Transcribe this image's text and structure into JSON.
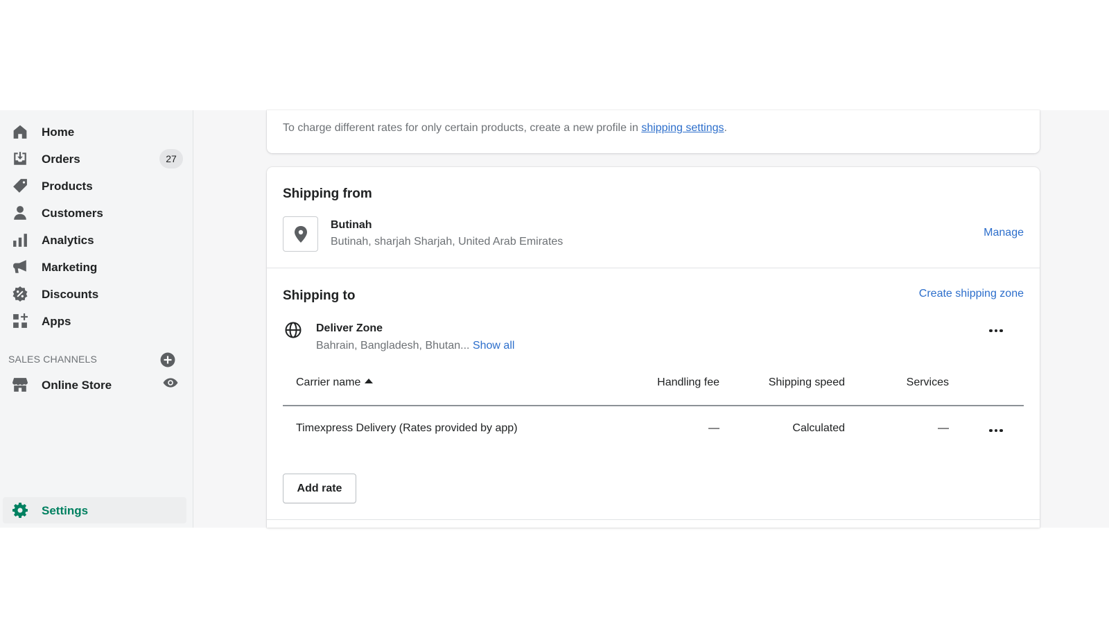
{
  "sidebar": {
    "items": [
      {
        "label": "Home",
        "icon": "home-icon"
      },
      {
        "label": "Orders",
        "icon": "orders-icon",
        "badge": "27"
      },
      {
        "label": "Products",
        "icon": "tag-icon"
      },
      {
        "label": "Customers",
        "icon": "person-icon"
      },
      {
        "label": "Analytics",
        "icon": "bar-chart-icon"
      },
      {
        "label": "Marketing",
        "icon": "megaphone-icon"
      },
      {
        "label": "Discounts",
        "icon": "discount-icon"
      },
      {
        "label": "Apps",
        "icon": "apps-icon"
      }
    ],
    "sales_channels_heading": "SALES CHANNELS",
    "online_store": "Online Store",
    "settings": "Settings"
  },
  "main": {
    "note_text": "To charge different rates for only certain products, create a new profile in ",
    "note_link": "shipping settings",
    "note_end": ".",
    "shipping_from": {
      "heading": "Shipping from",
      "location_name": "Butinah",
      "location_address": "Butinah, sharjah Sharjah, United Arab Emirates",
      "manage": "Manage"
    },
    "shipping_to": {
      "heading": "Shipping to",
      "create_zone": "Create shipping zone",
      "zone_name": "Deliver Zone",
      "zone_countries": "Bahrain, Bangladesh, Bhutan...",
      "show_all": "Show all"
    },
    "table": {
      "headers": [
        "Carrier name",
        "Handling fee",
        "Shipping speed",
        "Services"
      ],
      "rows": [
        {
          "carrier": "Timexpress Delivery (Rates provided by app)",
          "handling_fee": "—",
          "shipping_speed": "Calculated",
          "services": "—"
        }
      ]
    },
    "add_rate": "Add rate"
  },
  "colors": {
    "accent": "#008060",
    "link": "#2c6ecb"
  }
}
